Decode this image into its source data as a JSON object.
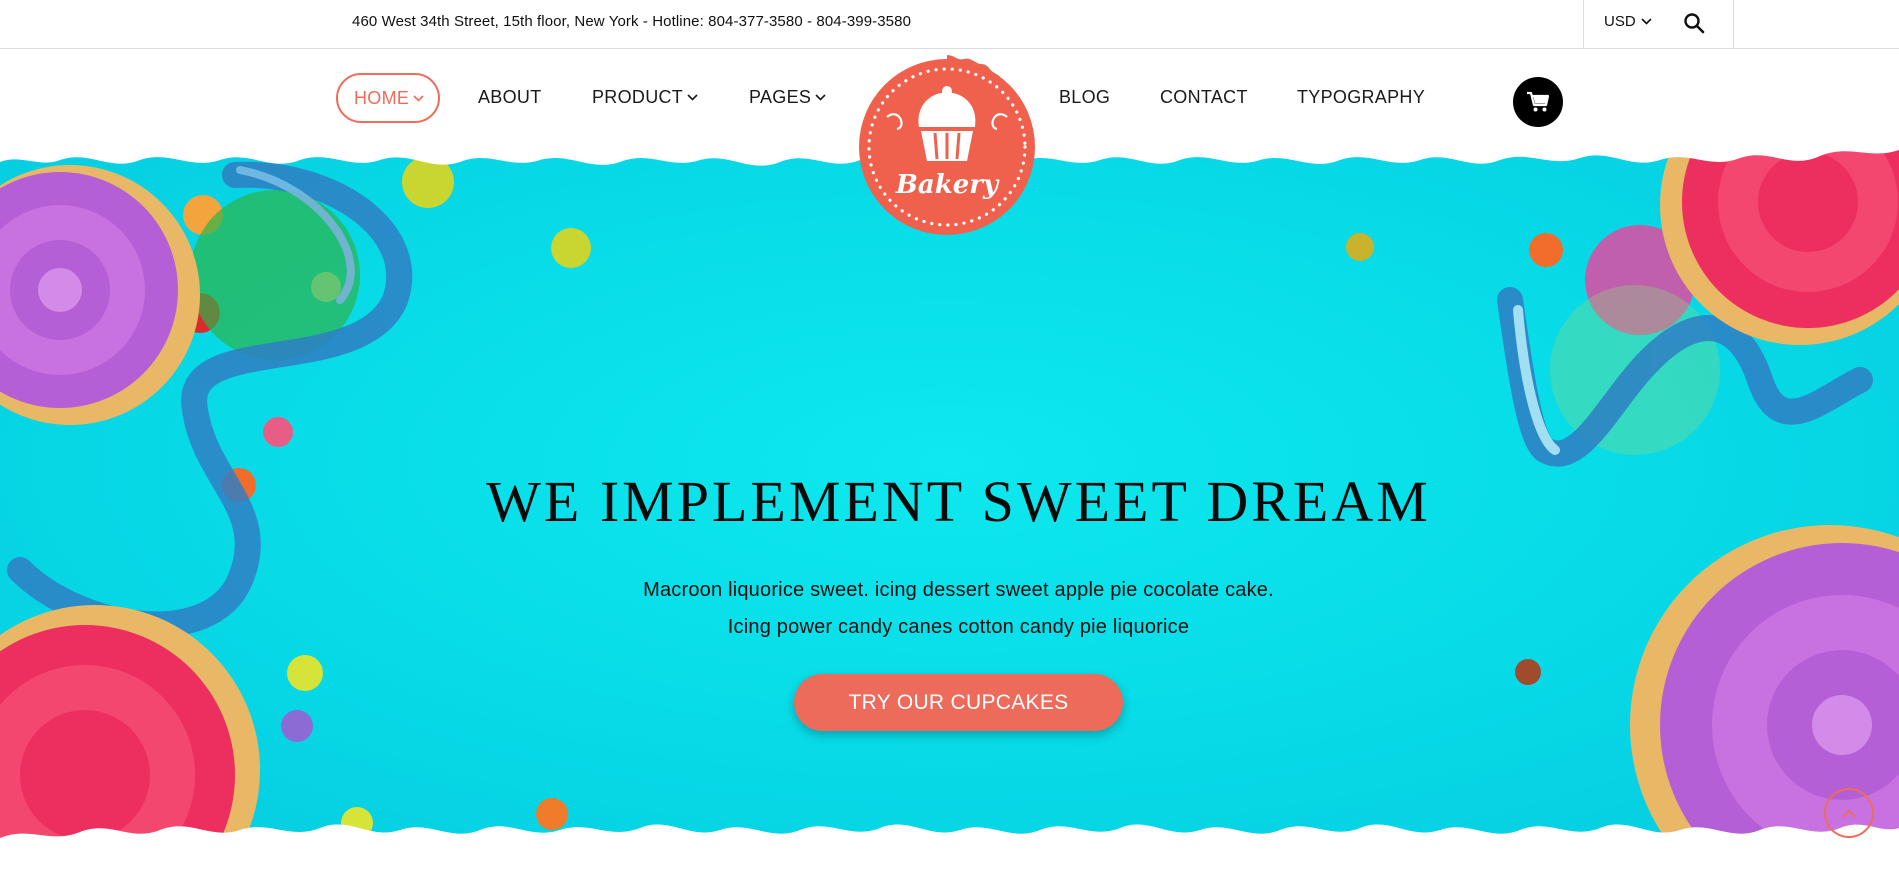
{
  "topbar": {
    "address": "460 West 34th Street, 15th floor, New York - Hotline: 804-377-3580 - 804-399-3580",
    "currency": "USD",
    "search_icon": "search-icon",
    "currency_icon": "chevron-down-icon"
  },
  "nav": {
    "left": [
      {
        "label": "HOME",
        "has_dropdown": true,
        "active": true
      },
      {
        "label": "ABOUT",
        "has_dropdown": false
      },
      {
        "label": "PRODUCT",
        "has_dropdown": true
      },
      {
        "label": "PAGES",
        "has_dropdown": true
      }
    ],
    "right": [
      {
        "label": "BLOG"
      },
      {
        "label": "CONTACT"
      },
      {
        "label": "TYPOGRAPHY"
      }
    ],
    "cart_icon": "cart-icon"
  },
  "logo": {
    "text": "Bakery",
    "icon": "cupcake-icon"
  },
  "hero": {
    "title": "WE IMPLEMENT SWEET DREAM",
    "subtitle_line1": "Macroon liquorice sweet. icing dessert sweet apple pie cocolate cake.",
    "subtitle_line2": "Icing power candy canes cotton candy pie liquorice",
    "cta_label": "TRY OUR CUPCAKES",
    "scroll_top_icon": "chevron-up-icon"
  },
  "colors": {
    "accent": "#ec6b5b",
    "hero_bg": "#08dde8",
    "text": "#111111",
    "cart_bg": "#000000"
  }
}
